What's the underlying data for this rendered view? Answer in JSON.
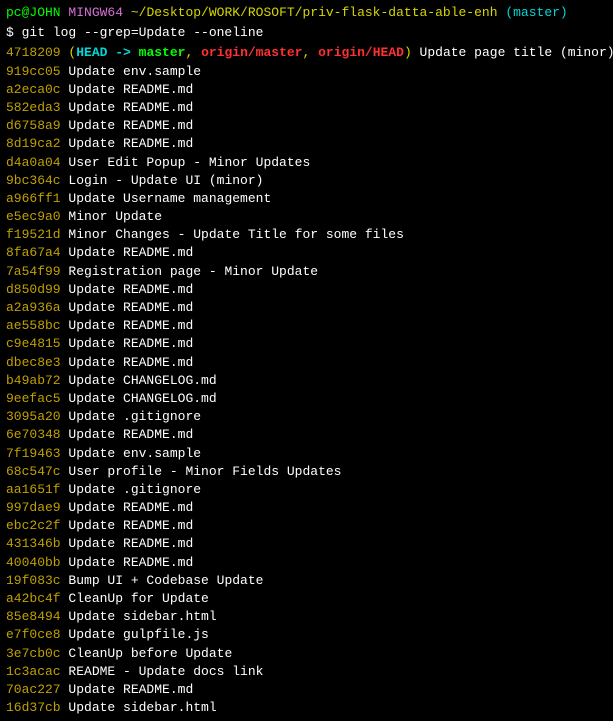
{
  "prompt": {
    "user_host": "pc@JOHN",
    "mingw": "MINGW64",
    "path": "~/Desktop/WORK/ROSOFT/priv-flask-datta-able-enh",
    "branch": "(master)"
  },
  "command": "$ git log --grep=Update --oneline",
  "first_commit": {
    "hash": "4718209",
    "open_paren": "(",
    "head_arrow": "HEAD -> ",
    "local_branch": "master",
    "comma1": ", ",
    "remote1": "origin/master",
    "comma2": ", ",
    "remote2": "origin/HEAD",
    "close_paren": ")",
    "msg": " Update page title (minor)"
  },
  "commits": [
    {
      "hash": "919cc05",
      "msg": "Update env.sample"
    },
    {
      "hash": "a2eca0c",
      "msg": "Update README.md"
    },
    {
      "hash": "582eda3",
      "msg": "Update README.md"
    },
    {
      "hash": "d6758a9",
      "msg": "Update README.md"
    },
    {
      "hash": "8d19ca2",
      "msg": "Update README.md"
    },
    {
      "hash": "d4a0a04",
      "msg": "User Edit Popup - Minor Updates"
    },
    {
      "hash": "9bc364c",
      "msg": "Login - Update UI (minor)"
    },
    {
      "hash": "a966ff1",
      "msg": "Update Username management"
    },
    {
      "hash": "e5ec9a0",
      "msg": "Minor Update"
    },
    {
      "hash": "f19521d",
      "msg": "Minor Changes - Update Title for some files"
    },
    {
      "hash": "8fa67a4",
      "msg": "Update README.md"
    },
    {
      "hash": "7a54f99",
      "msg": "Registration page - Minor Update"
    },
    {
      "hash": "d850d99",
      "msg": "Update README.md"
    },
    {
      "hash": "a2a936a",
      "msg": "Update README.md"
    },
    {
      "hash": "ae558bc",
      "msg": "Update README.md"
    },
    {
      "hash": "c9e4815",
      "msg": "Update README.md"
    },
    {
      "hash": "dbec8e3",
      "msg": "Update README.md"
    },
    {
      "hash": "b49ab72",
      "msg": "Update CHANGELOG.md"
    },
    {
      "hash": "9eefac5",
      "msg": "Update CHANGELOG.md"
    },
    {
      "hash": "3095a20",
      "msg": "Update .gitignore"
    },
    {
      "hash": "6e70348",
      "msg": "Update README.md"
    },
    {
      "hash": "7f19463",
      "msg": "Update env.sample"
    },
    {
      "hash": "68c547c",
      "msg": "User profile - Minor Fields Updates"
    },
    {
      "hash": "aa1651f",
      "msg": "Update .gitignore"
    },
    {
      "hash": "997dae9",
      "msg": "Update README.md"
    },
    {
      "hash": "ebc2c2f",
      "msg": "Update README.md"
    },
    {
      "hash": "431346b",
      "msg": "Update README.md"
    },
    {
      "hash": "40040bb",
      "msg": "Update README.md"
    },
    {
      "hash": "19f083c",
      "msg": "Bump UI + Codebase Update"
    },
    {
      "hash": "a42bc4f",
      "msg": "CleanUp for Update"
    },
    {
      "hash": "85e8494",
      "msg": "Update sidebar.html"
    },
    {
      "hash": "e7f0ce8",
      "msg": "Update gulpfile.js"
    },
    {
      "hash": "3e7cb0c",
      "msg": "CleanUp before Update"
    },
    {
      "hash": "1c3acac",
      "msg": "README - Update docs link"
    },
    {
      "hash": "70ac227",
      "msg": "Update README.md"
    },
    {
      "hash": "16d37cb",
      "msg": "Update sidebar.html"
    }
  ]
}
